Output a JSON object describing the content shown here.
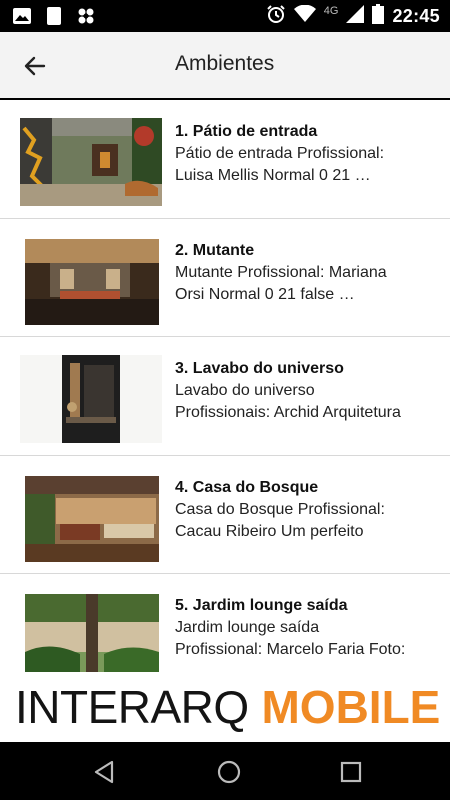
{
  "status_bar": {
    "time": "22:45",
    "network": "4G",
    "icons": [
      "image-icon",
      "moon-sim-icon",
      "app-notification-icon",
      "alarm-icon",
      "wifi-icon",
      "signal-icon",
      "battery-icon"
    ]
  },
  "app_bar": {
    "title": "Ambientes",
    "back_icon": "arrow-left-icon"
  },
  "items": [
    {
      "title": "1. Pátio de entrada",
      "desc_line1": "Pátio de entrada Profissional:",
      "desc_line2": "Luisa Mellis Normal 0 21 …"
    },
    {
      "title": "2. Mutante",
      "desc_line1": "Mutante Profissional: Mariana",
      "desc_line2": "Orsi Normal 0 21 false …"
    },
    {
      "title": "3. Lavabo do universo",
      "desc_line1": "Lavabo do universo",
      "desc_line2": "Profissionais: Archid Arquitetura"
    },
    {
      "title": "4. Casa do Bosque",
      "desc_line1": "Casa do Bosque Profissional:",
      "desc_line2": "Cacau Ribeiro Um perfeito"
    },
    {
      "title": "5. Jardim lounge saída",
      "desc_line1": "Jardim lounge saída",
      "desc_line2": "Profissional: Marcelo Faria  Foto:"
    }
  ],
  "banner": {
    "part1": "INTERARQ",
    "part2": "MOBILE",
    "color_primary": "#141414",
    "color_accent": "#f08a24"
  },
  "nav_bar": {
    "back": "nav-back-triangle-icon",
    "home": "nav-home-circle-icon",
    "recents": "nav-recents-square-icon"
  }
}
